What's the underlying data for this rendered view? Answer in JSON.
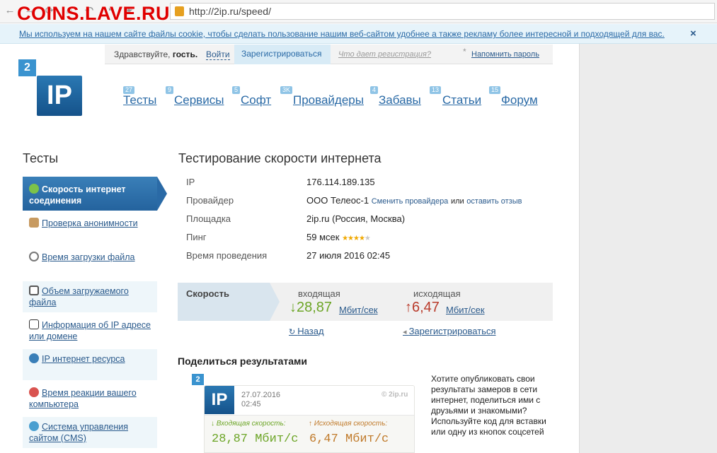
{
  "browser": {
    "url": "http://2ip.ru/speed/",
    "watermark": "COINS.LAVE.RU",
    "icons": [
      "back-icon",
      "forward-icon",
      "reload-icon",
      "home-icon",
      "history-icon",
      "downloads-icon",
      "bookmark-star-icon",
      "bookmark-icon",
      "lock-icon"
    ]
  },
  "cookie": {
    "text": "Мы используем на нашем сайте файлы cookie, чтобы сделать пользование нашим веб-сайтом удобнее а также рекламу более интересной и подходящей для вас.",
    "close": "×"
  },
  "userbar": {
    "greet": "Здравствуйте,",
    "guest": "гость.",
    "login": "Войти",
    "register": "Зарегистрироваться",
    "why": "Что дает регистрация?",
    "star": "*",
    "remind": "Напомнить пароль"
  },
  "logo": {
    "small": "2",
    "big": "IP"
  },
  "nav": [
    {
      "label": "Тесты",
      "badge": "27"
    },
    {
      "label": "Сервисы",
      "badge": "9"
    },
    {
      "label": "Софт",
      "badge": "5"
    },
    {
      "label": "Провайдеры",
      "badge": "3K"
    },
    {
      "label": "Забавы",
      "badge": "4"
    },
    {
      "label": "Статьи",
      "badge": "13"
    },
    {
      "label": "Форум",
      "badge": "15"
    }
  ],
  "sidebar": {
    "title": "Тесты",
    "items": [
      {
        "label": "Скорость интернет соединения",
        "icon": "speed-icon",
        "active": true
      },
      {
        "label": "Проверка анонимности",
        "icon": "anonymity-icon"
      },
      {
        "label": "Время загрузки файла",
        "icon": "clock-icon"
      },
      {
        "label": "Объем загружаемого файла",
        "icon": "file-size-icon"
      },
      {
        "label": "Информация об IP адресе или домене",
        "icon": "ip-info-icon"
      },
      {
        "label": "IP интернет ресурса",
        "icon": "ip-resource-icon"
      },
      {
        "label": "Время реакции вашего компьютера",
        "icon": "reaction-icon"
      },
      {
        "label": "Система управления сайтом (CMS)",
        "icon": "cms-icon"
      }
    ]
  },
  "content": {
    "title": "Тестирование скорости интернета",
    "rows": {
      "ip": {
        "label": "IP",
        "value": "176.114.189.135"
      },
      "provider": {
        "label": "Провайдер",
        "value": "ООО Телеос-1",
        "change": "Сменить провайдера",
        "or": "или",
        "review": "оставить отзыв"
      },
      "site": {
        "label": "Площадка",
        "value": "2ip.ru (Россия, Москва)"
      },
      "ping": {
        "label": "Пинг",
        "value": "59 мсек",
        "stars_on": "★★★★",
        "stars_off": "★",
        "rating": 4,
        "rating_max": 5
      },
      "time": {
        "label": "Время проведения",
        "value": "27 июля 2016 02:45"
      }
    },
    "speed": {
      "label": "Скорость",
      "in_label": "входящая",
      "out_label": "исходящая",
      "in_arrow": "↓",
      "out_arrow": "↑",
      "in_value": "28,87",
      "out_value": "6,47",
      "unit": "Мбит/сек"
    },
    "back": "Назад",
    "register": "Зарегистрироваться"
  },
  "share": {
    "title": "Поделиться результатами",
    "mini_logo": "2",
    "card_logo": "IP",
    "date": "27.07.2016",
    "time": "02:45",
    "site": "© 2ip.ru",
    "in_label": "↓ Входящая скорость:",
    "out_label": "↑ Исходящая скорость:",
    "in_value": "28,87 Мбит/с",
    "out_value": "6,47 Мбит/с",
    "text": "Хотите опубликовать свои результаты замеров в сети интернет, поделиться ими с друзьями и знакомыми? Используйте код для вставки или одну из кнопок соцсетей"
  },
  "colors": {
    "accent": "#2a6aa6",
    "in_speed": "#6ca526",
    "out_speed": "#b93a2a",
    "star": "#f0a800"
  }
}
